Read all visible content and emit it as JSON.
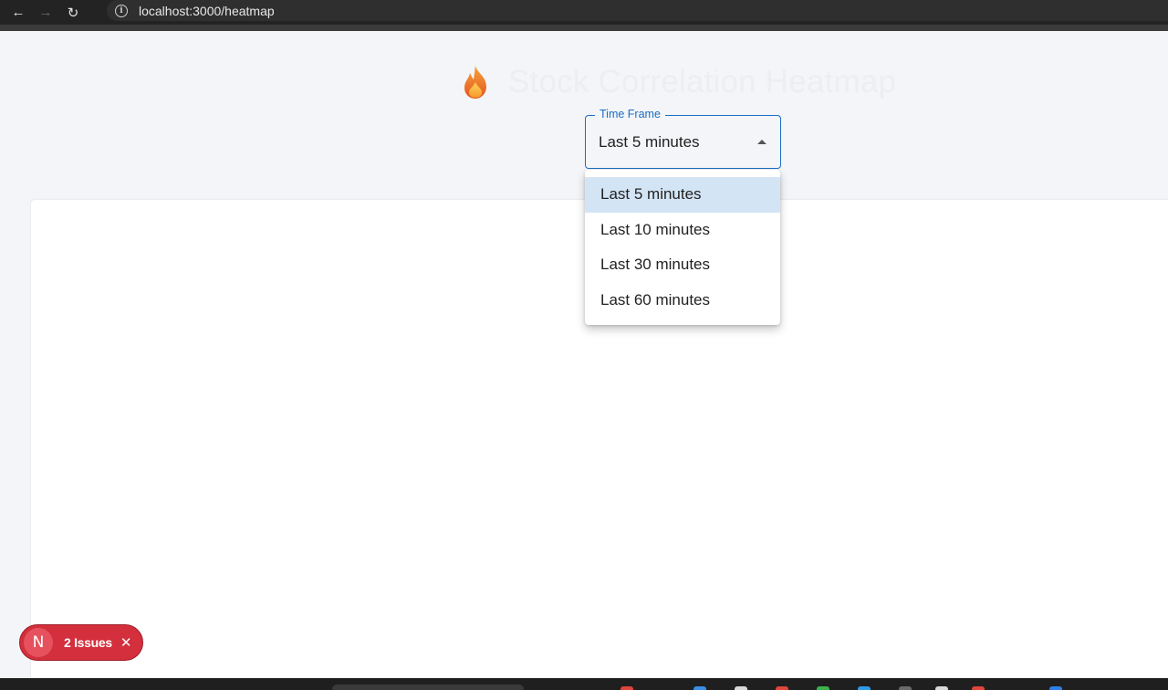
{
  "browser": {
    "url": "localhost:3000/heatmap",
    "back_icon": "arrow-left-icon",
    "forward_icon": "arrow-right-icon",
    "reload_icon": "reload-icon",
    "info_icon": "info-icon"
  },
  "header": {
    "icon": "flame-icon",
    "title": "Stock Correlation Heatmap"
  },
  "timeframe": {
    "label": "Time Frame",
    "value": "Last 5 minutes",
    "options": [
      "Last 5 minutes",
      "Last 10 minutes",
      "Last 30 minutes",
      "Last 60 minutes"
    ],
    "selected_index": 0
  },
  "issues_badge": {
    "logo": "N",
    "label": "2 Issues",
    "close_icon": "close-icon"
  },
  "colors": {
    "accent": "#1c6ec6",
    "selected_option_bg": "#d3e4f5",
    "issues_bg": "#d32f3c",
    "page_bg": "#f3f5f8"
  }
}
